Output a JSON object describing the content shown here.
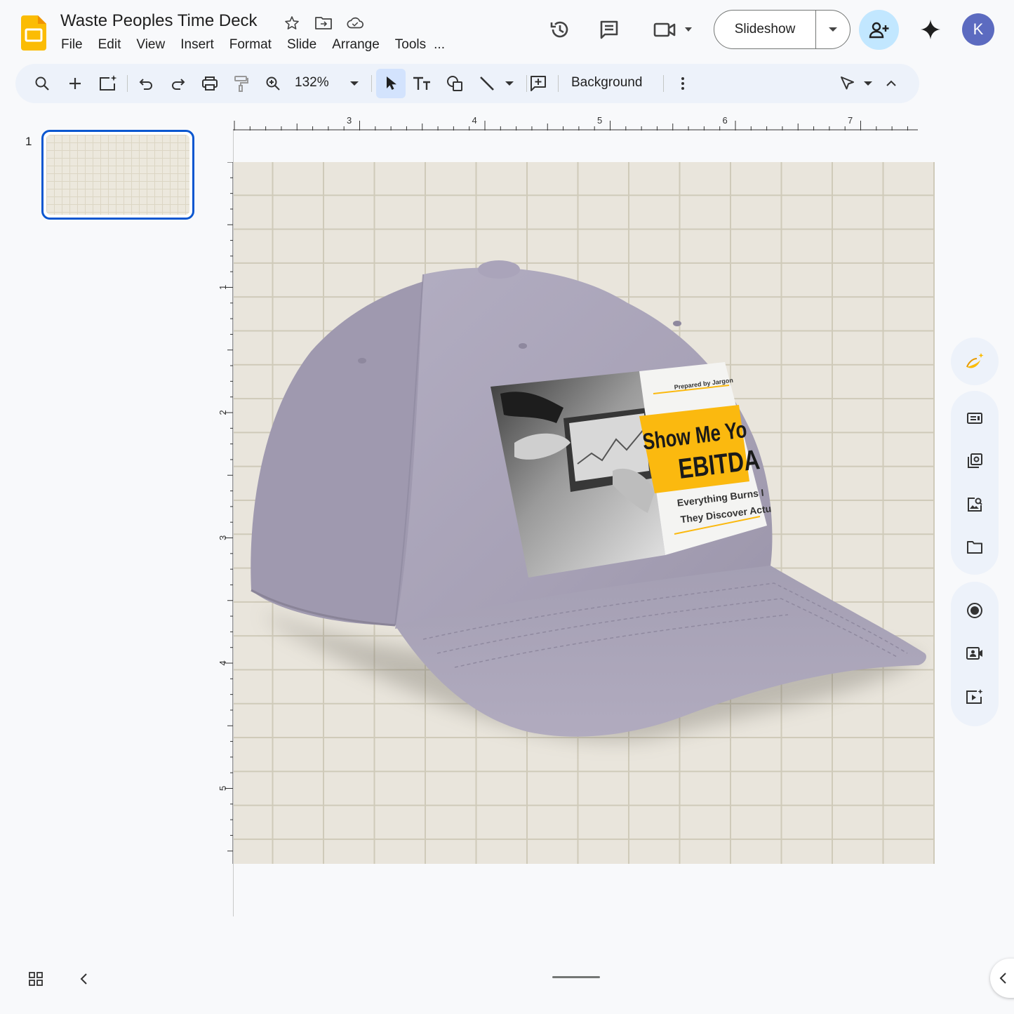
{
  "app": {
    "title": "Waste Peoples Time Deck",
    "brand_color": "#fbbc04"
  },
  "menu": [
    "File",
    "Edit",
    "View",
    "Insert",
    "Format",
    "Slide",
    "Arrange",
    "Tools",
    "..."
  ],
  "header": {
    "slideshow_label": "Slideshow",
    "avatar_initial": "K",
    "icons": [
      "star-icon",
      "move-to-folder-icon",
      "cloud-saved-icon",
      "version-history-icon",
      "comments-icon",
      "meet-icon",
      "share-icon",
      "gemini-icon"
    ]
  },
  "toolbar": {
    "zoom": "132%",
    "background_label": "Background",
    "icons": [
      "search-icon",
      "new-slide-icon",
      "new-slide-ai-icon",
      "undo-icon",
      "redo-icon",
      "print-icon",
      "paint-format-icon",
      "zoom-icon",
      "select-icon",
      "text-box-icon",
      "shape-icon",
      "line-icon",
      "comment-add-icon",
      "more-icon",
      "pointer-mode-icon",
      "collapse-toolbar-icon"
    ]
  },
  "filmstrip": {
    "slides": [
      {
        "number": "1",
        "selected": true
      }
    ]
  },
  "rulers": {
    "horizontal_labels": [
      "3",
      "4",
      "5",
      "6",
      "7"
    ],
    "vertical_labels": [
      "1",
      "2",
      "3",
      "4",
      "5"
    ]
  },
  "slide": {
    "image": {
      "description_icon": "cap-image",
      "cap_color": "#a9a3b8",
      "label": {
        "top_line": "Prepared by Jargon",
        "headline_1": "Show Me Yo",
        "headline_2": "EBITDA",
        "sub_1": "Everything Burns I",
        "sub_2": "They Discover Actu",
        "accent": "#fbb90f"
      }
    }
  },
  "side_panel": {
    "icons": [
      "banana-ai-icon",
      "text-layout-icon",
      "slide-library-icon",
      "image-search-icon",
      "folder-icon",
      "record-icon",
      "camera-record-icon",
      "video-spark-icon"
    ]
  }
}
